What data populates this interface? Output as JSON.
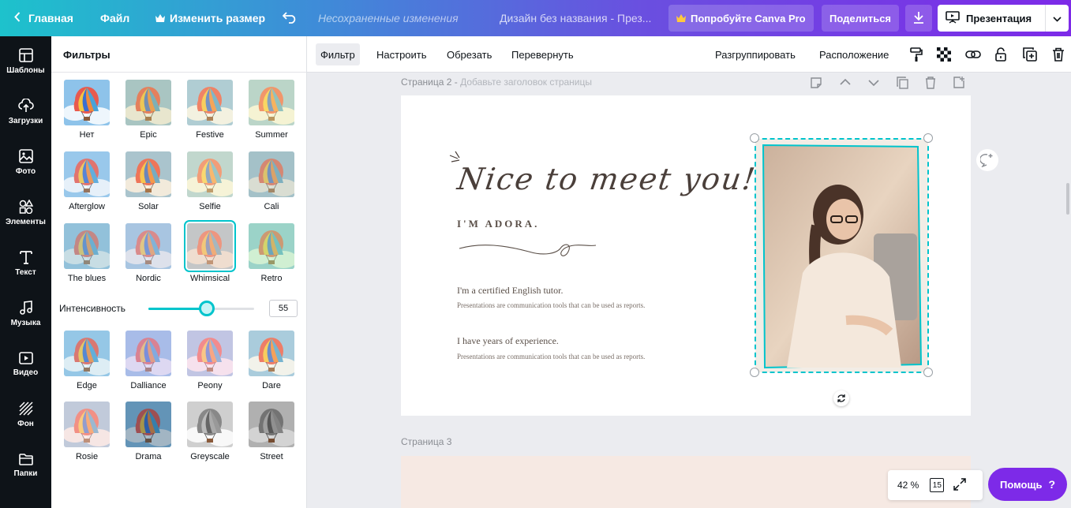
{
  "topbar": {
    "home_label": "Главная",
    "file_label": "Файл",
    "resize_label": "Изменить размер",
    "unsaved": "Несохраненные изменения",
    "doc_title": "Дизайн без названия - През...",
    "try_pro": "Попробуйте Canva Pro",
    "share": "Поделиться",
    "present": "Презентация"
  },
  "rail": [
    {
      "label": "Шаблоны",
      "icon": "templates-icon"
    },
    {
      "label": "Загрузки",
      "icon": "upload-icon"
    },
    {
      "label": "Фото",
      "icon": "photo-icon"
    },
    {
      "label": "Элементы",
      "icon": "elements-icon"
    },
    {
      "label": "Текст",
      "icon": "text-icon"
    },
    {
      "label": "Музыка",
      "icon": "music-icon"
    },
    {
      "label": "Видео",
      "icon": "video-icon"
    },
    {
      "label": "Фон",
      "icon": "background-icon"
    },
    {
      "label": "Папки",
      "icon": "folder-icon"
    }
  ],
  "panel": {
    "title": "Фильтры",
    "filters_top": [
      "Нет",
      "Epic",
      "Festive",
      "Summer",
      "Afterglow",
      "Solar",
      "Selfie",
      "Cali",
      "The blues",
      "Nordic",
      "Whimsical",
      "Retro"
    ],
    "filters_bottom": [
      "Edge",
      "Dalliance",
      "Peony",
      "Dare",
      "Rosie",
      "Drama",
      "Greyscale",
      "Street"
    ],
    "selected_filter": "Whimsical",
    "intensity_label": "Интенсивность",
    "intensity_value": "55",
    "intensity_fraction": 0.55
  },
  "toolbar": {
    "filter": "Фильтр",
    "adjust": "Настроить",
    "crop": "Обрезать",
    "flip": "Перевернуть",
    "ungroup": "Разгруппировать",
    "position": "Расположение"
  },
  "canvas": {
    "page2_label": "Страница 2 - ",
    "page2_placeholder": "Добавьте заголовок страницы",
    "page3_label": "Страница 3",
    "slide": {
      "script_title": "Nice to meet you!",
      "name": "I'M ADORA.",
      "line1": "I'm a certified English tutor.",
      "line1_sub": "Presentations are communication tools that can be used as reports.",
      "line2": "I have years of experience.",
      "line2_sub": "Presentations are communication tools that can be used as reports."
    }
  },
  "zoom": {
    "value": "42 %",
    "pages": "15"
  },
  "help": {
    "label": "Помощь",
    "mark": "?"
  },
  "colors": {
    "accent": "#00c4cc",
    "purple": "#7d2ae8",
    "rail": "#0e1318"
  }
}
